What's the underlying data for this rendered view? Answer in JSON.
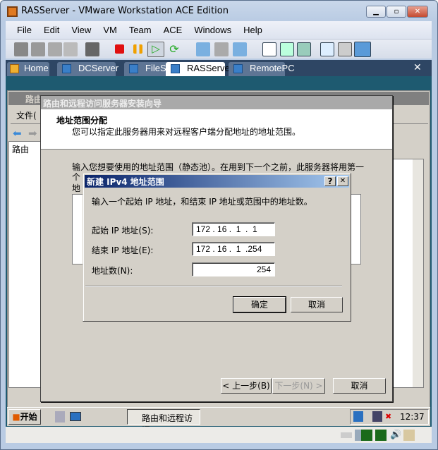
{
  "window": {
    "title": "RASServer - VMware Workstation ACE Edition",
    "minimize": "▁",
    "maximize": "▫",
    "close": "✕"
  },
  "menu": [
    "File",
    "Edit",
    "View",
    "VM",
    "Team",
    "ACE",
    "Windows",
    "Help"
  ],
  "tabs": [
    {
      "label": "Home"
    },
    {
      "label": "DCServer"
    },
    {
      "label": "FileServer"
    },
    {
      "label": "RASServer",
      "active": true
    },
    {
      "label": "RemotePC"
    }
  ],
  "tabs_close": "✕",
  "mmc": {
    "title": "路由",
    "menu_file": "文件(",
    "tree_root": "路由"
  },
  "wizard": {
    "title": "路由和远程访问服务器安装向导",
    "heading": "地址范围分配",
    "subheading": "您可以指定此服务器用来对远程客户端分配地址的地址范围。",
    "body_line1": "输入您想要使用的地址范围（静态池）。在用到下一个之前，此服务器将用第一",
    "body_line2": "个",
    "body_line3": "地",
    "back": "< 上一步(B)",
    "next": "下一步(N) >",
    "cancel": "取消"
  },
  "dialog": {
    "title": "新建 IPv4 地址范围",
    "help": "?",
    "close": "✕",
    "instruction": "输入一个起始 IP 地址，和结束 IP 地址或范围中的地址数。",
    "start_label": "起始 IP 地址(S):",
    "start_value": "172 . 16 .  1  .  1",
    "end_label": "结束 IP 地址(E):",
    "end_value": "172 . 16 .  1  .254",
    "count_label": "地址数(N):",
    "count_value": "254",
    "ok": "确定",
    "cancel": "取消"
  },
  "taskbar": {
    "start": "开始",
    "task": "路由和远程访问",
    "clock": "12:37"
  },
  "colors": {
    "dialog_title_start": "#0a246a",
    "dialog_title_end": "#a6caf0",
    "vm_bg": "#1e5a70",
    "tabbar": "#2e4664"
  }
}
